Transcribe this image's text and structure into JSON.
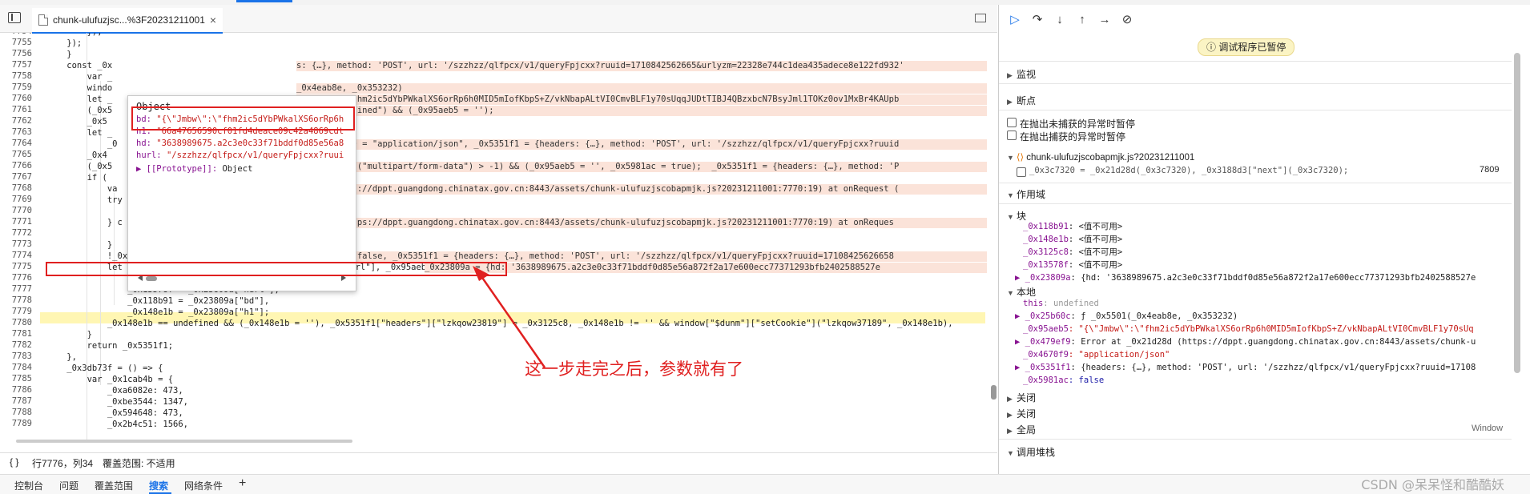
{
  "file_tab": {
    "name": "chunk-ulufuzjsc...%3F20231211001",
    "close": "×"
  },
  "code_lines": [
    {
      "n": "7754",
      "text": "        });"
    },
    {
      "n": "7755",
      "text": "    });"
    },
    {
      "n": "7756",
      "text": "    }"
    },
    {
      "n": "7757",
      "text": "    const _0x"
    },
    {
      "n": "7758",
      "text": "        var _"
    },
    {
      "n": "7759",
      "text": "        windo"
    },
    {
      "n": "7760",
      "text": "        let _"
    },
    {
      "n": "7761",
      "text": "        (_0x5"
    },
    {
      "n": "7762",
      "text": "        _0x5"
    },
    {
      "n": "7763",
      "text": "        let _"
    },
    {
      "n": "7764",
      "text": "            _0"
    },
    {
      "n": "7765",
      "text": "        _0x4"
    },
    {
      "n": "7766",
      "text": "        (_0x5"
    },
    {
      "n": "7767",
      "text": "        if ("
    },
    {
      "n": "7768",
      "text": "            va"
    },
    {
      "n": "7769",
      "text": "            try"
    },
    {
      "n": "7770",
      "text": "            "
    },
    {
      "n": "7771",
      "text": "            } c"
    },
    {
      "n": "7772",
      "text": "            "
    },
    {
      "n": "7773",
      "text": "            }"
    },
    {
      "n": "7774",
      "text": "            !_0x5981ac && (_0x5351f1[\"body\"] = _0x95aeb5);"
    },
    {
      "n": "7775",
      "text": "            let _0x23809a = window[\"ssx91m$212\"](_0x5351f1[\"url\"], _0x95aeb5, _0x479ef9);"
    },
    {
      "n": "7776",
      "text": "                _0x3125c8 = _0x23809a[\"hd\"],"
    },
    {
      "n": "7777",
      "text": "                _0x13578f = _0x23809a[\"hurl\"],"
    },
    {
      "n": "7778",
      "text": "                _0x118b91 = _0x23809a[\"bd\"],"
    },
    {
      "n": "7779",
      "text": "                _0x148e1b = _0x23809a[\"h1\"];"
    },
    {
      "n": "7780",
      "text": "            _0x148e1b == undefined && (_0x148e1b = ''), _0x5351f1[\"headers\"][\"lzkqow23819\"] = _0x3125c8, _0x148e1b != '' && window[\"$dunm\"][\"setCookie\"](\"lzkqow37189\", _0x148e1b),"
    },
    {
      "n": "7781",
      "text": "        }"
    },
    {
      "n": "7782",
      "text": "        return _0x5351f1;"
    },
    {
      "n": "7783",
      "text": "    },"
    },
    {
      "n": "7784",
      "text": "    _0x3db73f = () => {"
    },
    {
      "n": "7785",
      "text": "        var _0x1cab4b = {"
    },
    {
      "n": "7786",
      "text": "            _0xa6082e: 473,"
    },
    {
      "n": "7787",
      "text": "            _0xbe3544: 1347,"
    },
    {
      "n": "7788",
      "text": "            _0x594648: 473,"
    },
    {
      "n": "7789",
      "text": "            _0x2b4c51: 1566,"
    }
  ],
  "inline_values": [
    {
      "line": 3,
      "text": "s: {…}, method: 'POST', url: '/szzhzz/qlfpcx/v1/queryFpjcxx?ruuid=1710842562665&urlyzm=22328e744c1dea435adece8e122fd932'"
    },
    {
      "line": 5,
      "text": "_0x4eab8e, _0x353232)"
    },
    {
      "line": 6,
      "text": "\\\"Jmbw\\\":\\\"fhm2ic5dYbPWkalXS6orRp6h0MID5mIofKbpS+Z/vkNbapALtVI0CmvBLF1y70sUqqJUDtTIBJ4QBzxbcN7BsyJml1TOKz0ov1MxBr4KAUpb"
    },
    {
      "line": 7,
      "text": "\"] == \"undefined\") && (_0x95aeb5 = '');"
    },
    {
      "line": 10,
      "text": ";  _0x4670f9 = \"application/json\", _0x5351f1 = {headers: {…}, method: 'POST', url: '/szzhzz/qlfpcx/v1/queryFpjcxx?ruuid"
    },
    {
      "line": 12,
      "text": "9[\"indexOf\"](\"multipart/form-data\") > -1) && (_0x95aeb5 = '', _0x5981ac = true);  _0x5351f1 = {headers: {…}, method: 'P"
    },
    {
      "line": 14,
      "text": "1d28d (https://dppt.guangdong.chinatax.gov.cn:8443/assets/chunk-ulufuzjscobapmjk.js?20231211001:7770:19) at onRequest ("
    },
    {
      "line": 17,
      "text": "x21d28d (https://dppt.guangdong.chinatax.gov.cn:8443/assets/chunk-ulufuzjscobapmjk.js?20231211001:7770:19) at onReques"
    },
    {
      "line": 20,
      "text": "_0x5981ac = false, _0x5351f1 = {headers: {…}, method: 'POST', url: '/szzhzz/qlfpcx/v1/queryFpjcxx?ruuid=17108425626658"
    },
    {
      "line": 21,
      "text": "_0x23809a = {hd: '3638989675.a2c3e0c33f71bddf0d85e56a872f2a17e600ecc77371293bfb2402588527e"
    }
  ],
  "popover": {
    "title": "Object",
    "rows": [
      {
        "k": "bd: ",
        "v": "\"{\\\"Jmbw\\\":\\\"fhm2ic5dYbPWkalXS6orRp6h"
      },
      {
        "k": "h1: ",
        "v": "\"66a47656590cf01fd4deace09c42a4869cdt"
      },
      {
        "k": "hd: ",
        "v": "\"3638989675.a2c3e0c33f71bddf0d85e56a8"
      },
      {
        "k": "hurl: ",
        "v": "\"/szzhzz/qlfpcx/v1/queryFpjcxx?ruui"
      },
      {
        "k": "▶ [[Prototype]]: ",
        "v": "Object"
      }
    ]
  },
  "annotation": "这一步走完之后，参数就有了",
  "status": {
    "braces": "{ }",
    "position": "行7776，列34",
    "coverage": "覆盖范围: 不适用"
  },
  "drawer_tabs": [
    "控制台",
    "问题",
    "覆盖范围",
    "搜索",
    "网络条件",
    "+"
  ],
  "debugger": {
    "paused": "ⓘ 调试程序已暂停",
    "sections": {
      "watch": "监视",
      "breakpoints": "断点",
      "scope": "作用域",
      "callstack": "调用堆栈"
    },
    "bp_options": [
      "在抛出未捕获的异常时暂停",
      "在抛出捕获的异常时暂停"
    ],
    "bp_file": "chunk-ulufuzjscobapmjk.js?20231211001",
    "bp_code": "_0x3c7320 = _0x21d28d(_0x3c7320), _0x3188d3[\"next\"](_0x3c7320);",
    "bp_line": "7809",
    "block_label": "块",
    "block_vars": [
      {
        "k": "_0x118b91",
        "v": ": <值不可用>"
      },
      {
        "k": "_0x148e1b",
        "v": ": <值不可用>"
      },
      {
        "k": "_0x3125c8",
        "v": ": <值不可用>"
      },
      {
        "k": "_0x13578f",
        "v": ": <值不可用>"
      },
      {
        "k": "▶ _0x23809a",
        "v": ": {hd: '3638989675.a2c3e0c33f71bddf0d85e56a872f2a17e600ecc77371293bfb2402588527e"
      }
    ],
    "local_label": "本地",
    "local_vars": [
      {
        "k": "this",
        "v": ": undefined"
      },
      {
        "k": "▶ _0x25b60c",
        "v": ": ƒ _0x5501(_0x4eab8e, _0x353232)"
      },
      {
        "k": "_0x95aeb5",
        "v": ": \"{\\\"Jmbw\\\":\\\"fhm2ic5dYbPWkalXS6orRp6h0MID5mIofKbpS+Z/vkNbapALtVI0CmvBLF1y70sUq"
      },
      {
        "k": "▶ _0x479ef9",
        "v": ": Error at _0x21d28d (https://dppt.guangdong.chinatax.gov.cn:8443/assets/chunk-u"
      },
      {
        "k": "_0x4670f9",
        "v": ": \"application/json\""
      },
      {
        "k": "▶ _0x5351f1",
        "v": ": {headers: {…}, method: 'POST', url: '/szzhzz/qlfpcx/v1/queryFpjcxx?ruuid=17108"
      },
      {
        "k": "_0x5981ac",
        "v": ": false"
      }
    ],
    "closures": [
      "关闭",
      "关闭"
    ],
    "global": "全局",
    "global_value": "Window"
  },
  "watermark": "CSDN @呆呆怪和酷酷妖"
}
